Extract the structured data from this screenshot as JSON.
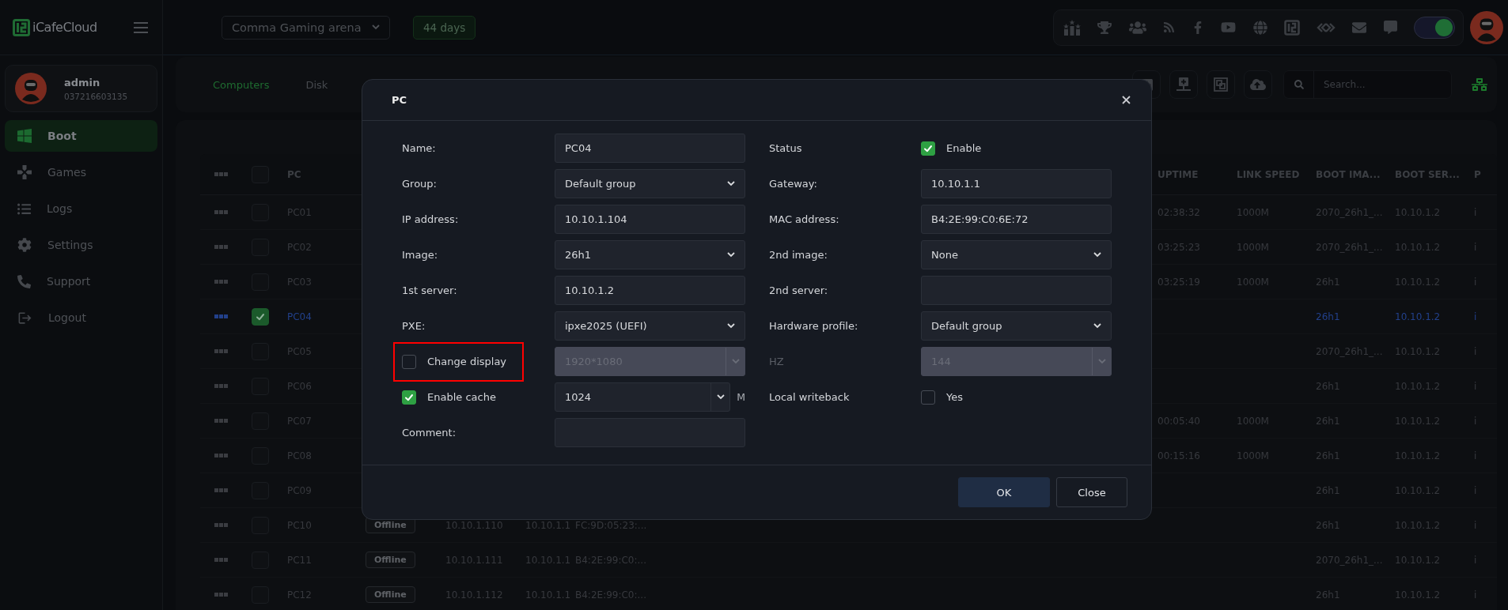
{
  "sidebar": {
    "logo": "iCafeCloud",
    "user": {
      "name": "admin",
      "phone": "037216603135"
    },
    "nav": [
      {
        "label": "Boot",
        "selected": true
      },
      {
        "label": "Games",
        "selected": false
      },
      {
        "label": "Logs",
        "selected": false
      },
      {
        "label": "Settings",
        "selected": false
      },
      {
        "label": "Support",
        "selected": false
      },
      {
        "label": "Logout",
        "selected": false
      }
    ]
  },
  "topbar": {
    "venue": "Comma Gaming arena",
    "license": "44 days",
    "theme_toggle": {
      "on": true
    }
  },
  "tabs": [
    {
      "label": "Computers",
      "selected": true
    },
    {
      "label": "Disk",
      "selected": false
    }
  ],
  "search": {
    "placeholder": "Search..."
  },
  "table": {
    "select_all": {
      "checked": false
    },
    "columns": [
      {
        "label": "PC"
      },
      {
        "label": "UPTIME"
      },
      {
        "label": "LINK SPEED"
      },
      {
        "label": "BOOT IMA..."
      },
      {
        "label": "BOOT SER..."
      },
      {
        "label": "P"
      }
    ],
    "rows": [
      {
        "pc": "PC01",
        "selected": false,
        "checked": false,
        "uptime": "02:38:32",
        "link_speed": "1000M",
        "boot_image": "2070_26h1_...",
        "boot_server": "10.10.1.2",
        "column_12": "i"
      },
      {
        "pc": "PC02",
        "selected": false,
        "checked": false,
        "uptime": "03:25:23",
        "link_speed": "1000M",
        "boot_image": "2070_26h1_...",
        "boot_server": "10.10.1.2",
        "column_12": "i"
      },
      {
        "pc": "PC03",
        "selected": false,
        "checked": false,
        "uptime": "03:25:19",
        "link_speed": "1000M",
        "boot_image": "26h1",
        "boot_server": "10.10.1.2",
        "column_12": "i"
      },
      {
        "pc": "PC04",
        "selected": true,
        "checked": true,
        "boot_image": "26h1",
        "boot_server": "10.10.1.2",
        "column_12": "i"
      },
      {
        "pc": "PC05",
        "selected": false,
        "checked": false,
        "boot_image": "2070_26h1_...",
        "boot_server": "10.10.1.2",
        "column_12": "i"
      },
      {
        "pc": "PC06",
        "selected": false,
        "checked": false,
        "boot_image": "26h1",
        "boot_server": "10.10.1.2",
        "column_12": "i"
      },
      {
        "pc": "PC07",
        "selected": false,
        "checked": false,
        "uptime": "00:05:40",
        "link_speed": "1000M",
        "boot_image": "26h1",
        "boot_server": "10.10.1.2",
        "column_12": "i"
      },
      {
        "pc": "PC08",
        "selected": false,
        "checked": false,
        "uptime": "00:15:16",
        "link_speed": "1000M",
        "boot_image": "26h1",
        "boot_server": "10.10.1.2",
        "column_12": "i"
      },
      {
        "pc": "PC09",
        "selected": false,
        "checked": false,
        "boot_image": "26h1",
        "boot_server": "10.10.1.2",
        "column_12": "i"
      },
      {
        "pc": "PC10",
        "selected": false,
        "checked": false,
        "status": "Offline",
        "ip": "10.10.1.110",
        "gateway": "10.10.1.1",
        "mac": "FC:9D:05:23:...",
        "boot_image": "26h1",
        "boot_server": "10.10.1.2",
        "column_12": "i"
      },
      {
        "pc": "PC11",
        "selected": false,
        "checked": false,
        "status": "Offline",
        "ip": "10.10.1.111",
        "gateway": "10.10.1.1",
        "mac": "B4:2E:99:C0:...",
        "boot_image": "2070_26h1_...",
        "boot_server": "10.10.1.2",
        "column_12": "i"
      },
      {
        "pc": "PC12",
        "selected": false,
        "checked": false,
        "status": "Offline",
        "ip": "10.10.1.112",
        "gateway": "10.10.1.1",
        "mac": "B4:2E:99:C0:...",
        "boot_image": "26h1",
        "boot_server": "10.10.1.2",
        "column_12": "i"
      }
    ]
  },
  "dialog": {
    "title": "PC",
    "rows": [
      {
        "left": {
          "label": "Name:",
          "control": {
            "kind": "text",
            "value": "PC04"
          }
        },
        "right": {
          "label": "Status",
          "control": {
            "kind": "check",
            "label": "Enable",
            "checked": true
          }
        }
      },
      {
        "left": {
          "label": "Group:",
          "control": {
            "kind": "select",
            "value": "Default group"
          }
        },
        "right": {
          "label": "Gateway:",
          "control": {
            "kind": "text",
            "value": "10.10.1.1"
          }
        }
      },
      {
        "left": {
          "label": "IP address:",
          "control": {
            "kind": "text",
            "value": "10.10.1.104"
          }
        },
        "right": {
          "label": "MAC address:",
          "control": {
            "kind": "text",
            "value": "B4:2E:99:C0:6E:72"
          }
        }
      },
      {
        "left": {
          "label": "Image:",
          "control": {
            "kind": "select",
            "value": "26h1"
          }
        },
        "right": {
          "label": "2nd image:",
          "control": {
            "kind": "select",
            "value": "None"
          }
        }
      },
      {
        "left": {
          "label": "1st server:",
          "control": {
            "kind": "text",
            "value": "10.10.1.2"
          }
        },
        "right": {
          "label": "2nd server:",
          "control": {
            "kind": "text"
          }
        }
      },
      {
        "left": {
          "label": "PXE:",
          "control": {
            "kind": "select",
            "value": "ipxe2025 (UEFI)"
          }
        },
        "right": {
          "label": "Hardware profile:",
          "control": {
            "kind": "select",
            "value": "Default group"
          }
        }
      },
      {
        "left": {
          "label": "Change display",
          "checkbox": {
            "checked": false
          },
          "highlighted": true,
          "control": {
            "kind": "combo",
            "value": "1920*1080",
            "disabled": true
          }
        },
        "right": {
          "label": "HZ",
          "disabled": true,
          "control": {
            "kind": "combo",
            "value": "144",
            "disabled": true
          }
        }
      },
      {
        "left": {
          "label": "Enable cache",
          "checkbox": {
            "checked": true
          },
          "control": {
            "kind": "combo",
            "value": "1024",
            "unit": "M",
            "disabled": false
          }
        },
        "right": {
          "label": "Local writeback",
          "control": {
            "kind": "check",
            "label": "Yes",
            "checked": false
          }
        }
      },
      {
        "left": {
          "label": "Comment:",
          "control": {
            "kind": "text"
          }
        }
      }
    ],
    "buttons": [
      {
        "label": "OK",
        "kind": "primary"
      },
      {
        "label": "Close",
        "kind": "secondary"
      }
    ]
  }
}
